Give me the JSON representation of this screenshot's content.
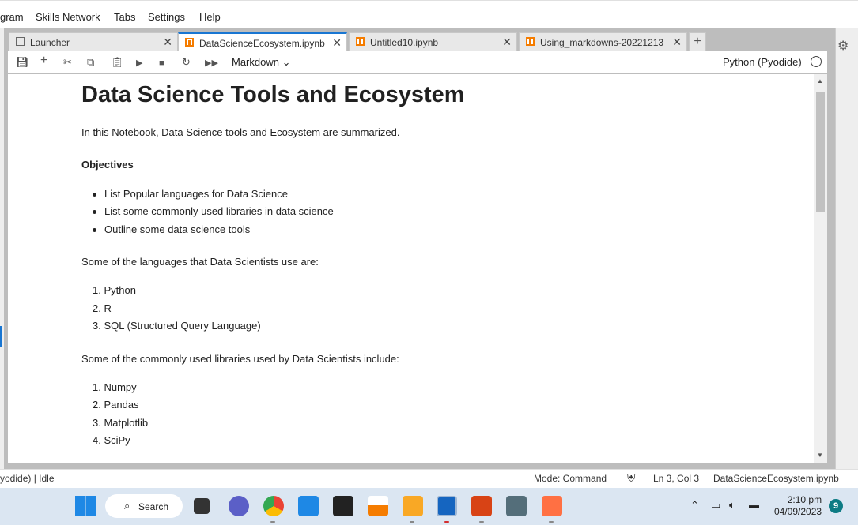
{
  "menu": {
    "items": [
      "gram",
      "Skills Network",
      "Tabs",
      "Settings",
      "Help"
    ]
  },
  "tabs": [
    {
      "label": "Launcher",
      "close": "✕"
    },
    {
      "label": "DataScienceEcosystem.ipynb",
      "close": "✕"
    },
    {
      "label": "Untitled10.ipynb",
      "close": "✕"
    },
    {
      "label": "Using_markdowns-20221213",
      "close": "✕"
    }
  ],
  "add_tab": "+",
  "toolbar": {
    "cell_type": "Markdown ⌄",
    "kernel": "Python (Pyodide)"
  },
  "notebook": {
    "title": "Data Science Tools and Ecosystem",
    "intro": "In this Notebook, Data Science tools and Ecosystem are summarized.",
    "objectives_heading": "Objectives",
    "objectives": [
      "List Popular languages for Data Science",
      "List some commonly used libraries in data science",
      "Outline some data science tools"
    ],
    "languages_intro": "Some of the languages that Data Scientists use are:",
    "languages": [
      "1. Python",
      "2. R",
      "3. SQL (Structured Query Language)"
    ],
    "libraries_intro": "Some of the commonly used libraries used by Data Scientists include:",
    "libraries": [
      "1. Numpy",
      "2. Pandas",
      "3. Matplotlib",
      "4. SciPy"
    ]
  },
  "status": {
    "left": "yodide) | Idle",
    "mode": "Mode: Command",
    "position": "Ln 3, Col 3",
    "file": "DataScienceEcosystem.ipynb"
  },
  "taskbar": {
    "search_label": "Search",
    "time": "2:10 pm",
    "date": "04/09/2023",
    "notifications": "9"
  },
  "colors": {
    "accent": "#1976d2",
    "notebook_icon": "#f57c00",
    "taskbar_bg": "#dbe6f2"
  }
}
